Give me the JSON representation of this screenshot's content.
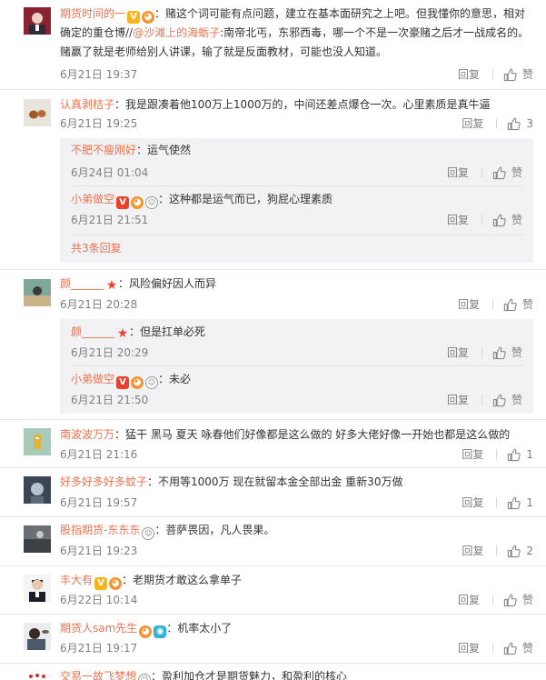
{
  "ui": {
    "reply": "回复",
    "like": "赞"
  },
  "comments": [
    {
      "user": "期货时间的一",
      "text1": "：赌这个词可能有点问题，建立在基本面研究之上吧。但我懂你的意思，相对",
      "text2a": "确定的重仓博//",
      "mention": "@沙滩上的海蛎子",
      "text2b": ":南帝北丐，东邪西毒，哪一个不是一次豪赌之后才一战成名的。",
      "text3": "赌赢了就是老师给别人讲课，输了就是反面教材，可能也没人知道。",
      "time": "6月21日 19:37",
      "likes": ""
    },
    {
      "user": "认真剥桔子",
      "text": "：我是跟凑着他100万上1000万的，中间还差点爆仓一次。心里素质是真牛逼",
      "time": "6月21日 19:25",
      "likes": "3",
      "subs": [
        {
          "user": "不肥不瘦刚好",
          "text": "：运气使然",
          "time": "6月24日 01:04",
          "likes": ""
        },
        {
          "user": "小弟做空",
          "text": "：这种都是运气而已，狗屁心理素质",
          "time": "6月21日 21:51",
          "likes": ""
        }
      ],
      "more": "共3条回复"
    },
    {
      "user": "颜______",
      "text": "：风险偏好因人而异",
      "time": "6月21日 20:28",
      "likes": "",
      "subs": [
        {
          "user": "颜______",
          "text": "：但是扛单必死",
          "time": "6月21日 20:29",
          "likes": ""
        },
        {
          "user": "小弟做空",
          "text": "：未必",
          "time": "6月21日 21:50",
          "likes": ""
        }
      ]
    },
    {
      "user": "南波波万万",
      "text": "：猛干  黑马  夏天  咏春他们好像都是这么做的  好多大佬好像一开始也都是这么做的",
      "time": "6月21日 21:16",
      "likes": "1"
    },
    {
      "user": "好多好多好多蚊子",
      "text": "：不用等1000万 现在就留本金全部出金 重新30万做",
      "time": "6月21日 19:57",
      "likes": "1"
    },
    {
      "user": "股指期货-东东东",
      "text": "：菩萨畏因，凡人畏果。",
      "time": "6月21日 19:23",
      "likes": "2"
    },
    {
      "user": "丰大有",
      "text": "：老期货才敢这么拿单子",
      "time": "6月22日 10:14",
      "likes": ""
    },
    {
      "user": "期货人sam先生",
      "text": "：机率太小了",
      "time": "6月21日 19:17",
      "likes": ""
    },
    {
      "user": "交易一故飞梦想",
      "text": "：盈利加仓才是期货魅力，和盈利的核心",
      "time": "",
      "likes": ""
    }
  ]
}
